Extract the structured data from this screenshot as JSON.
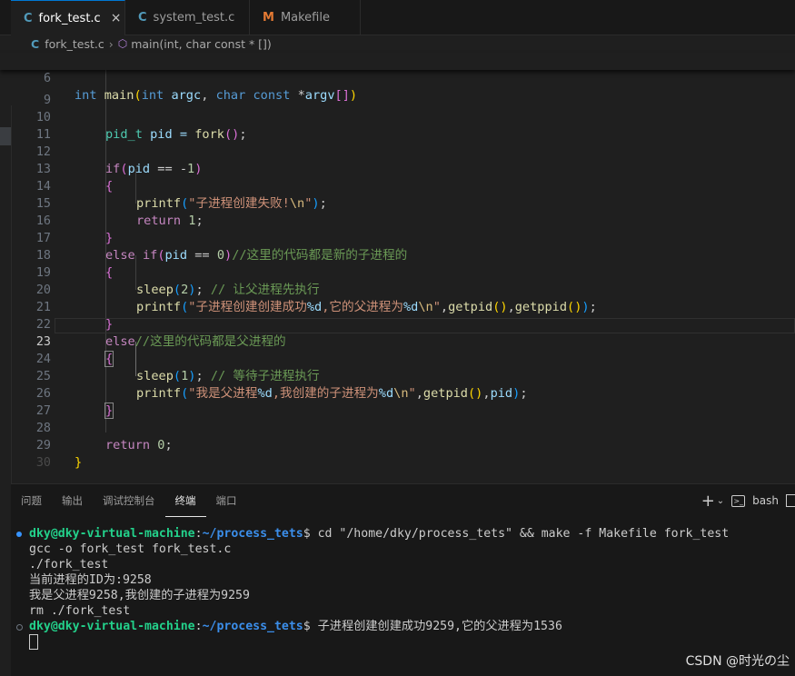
{
  "tabs": [
    {
      "icon": "C",
      "label": "fork_test.c",
      "close": "×"
    },
    {
      "icon": "C",
      "label": "system_test.c"
    },
    {
      "icon": "M",
      "label": "Makefile"
    }
  ],
  "breadcrumb": {
    "file": "fork_test.c",
    "symbol": "main(int, char const * [])"
  },
  "editor": {
    "sticky": {
      "num": "6"
    },
    "line_numbers": [
      "9",
      "10",
      "11",
      "12",
      "13",
      "14",
      "15",
      "16",
      "17",
      "18",
      "19",
      "20",
      "21",
      "22",
      "23",
      "24",
      "25",
      "26",
      "27",
      "28",
      "29",
      "30"
    ],
    "current_line": "23",
    "lines": {
      "l10_a": "pid_t",
      "l10_b": " pid = ",
      "l10_c": "fork",
      "l10_d": "();",
      "l14_str": "\"子进程创建失败!",
      "l14_esc": "\\n",
      "l17_cm": "//这里的代码都是新的子进程的",
      "l19_cm": "// 让父进程先执行",
      "l20_str1": "\"子进程创建创建成功",
      "l20_fmt1": "%d",
      "l20_str2": ",它的父进程为",
      "l20_fmt2": "%d",
      "l20_esc": "\\n",
      "l22_cm": "//这里的代码都是父进程的",
      "l24_cm": "// 等待子进程执行",
      "l25_str1": "\"我是父进程",
      "l25_fmt1": "%d",
      "l25_str2": ",我创建的子进程为",
      "l25_fmt2": "%d",
      "l25_esc": "\\n"
    }
  },
  "panel": {
    "tabs": [
      "问题",
      "输出",
      "调试控制台",
      "终端",
      "端口"
    ],
    "active_tab": "终端",
    "shell": "bash",
    "plus": "+"
  },
  "terminal": {
    "user": "dky@dky-virtual-machine",
    "path": "~/process_tets",
    "cmd1": "$ cd \"/home/dky/process_tets\" && make -f Makefile fork_test",
    "out1": "gcc -o fork_test fork_test.c",
    "out2": "./fork_test",
    "out3": "当前进程的ID为:9258",
    "out4": "我是父进程9258,我创建的子进程为9259",
    "out5": "rm ./fork_test",
    "cmd2": "$ 子进程创建创建成功9259,它的父进程为1536"
  },
  "watermark": "CSDN @时光の尘"
}
